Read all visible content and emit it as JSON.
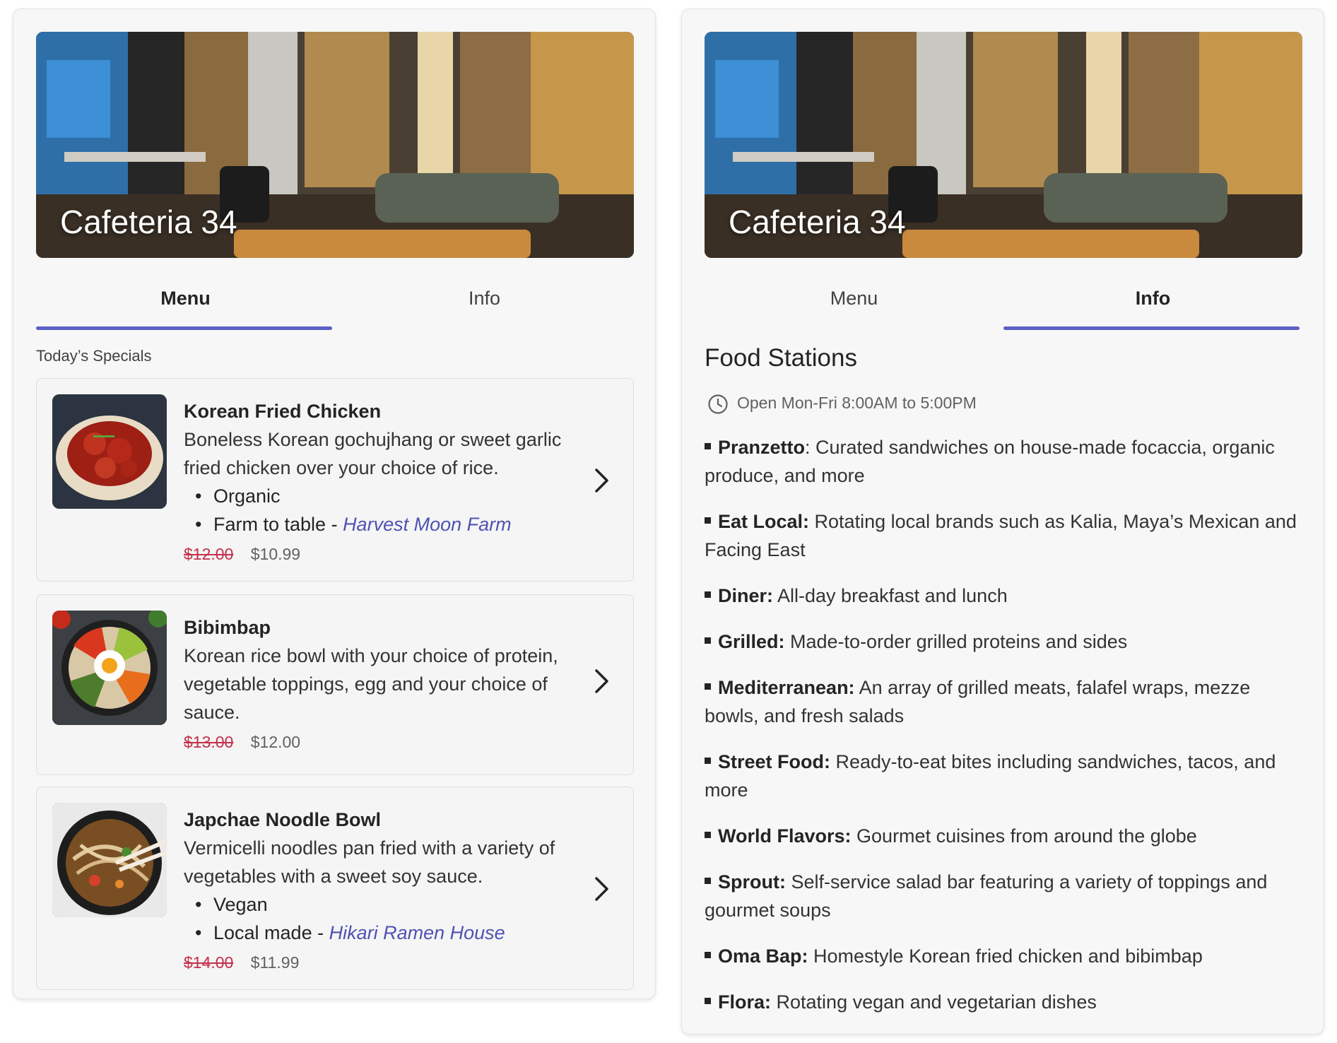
{
  "colors": {
    "accent": "#5b5fc7",
    "link": "#4f52b2",
    "strike_price": "#c4314b"
  },
  "menu_card": {
    "hero_title": "Cafeteria 34",
    "tabs": [
      {
        "label": "Menu",
        "active": true
      },
      {
        "label": "Info",
        "active": false
      }
    ],
    "section_label": "Today’s Specials",
    "items": [
      {
        "name": "Korean Fried Chicken",
        "description": "Boneless Korean gochujhang or sweet garlic fried chicken over your choice of rice.",
        "tags": [
          {
            "text": "Organic"
          },
          {
            "text": "Farm to table",
            "separator": " - ",
            "link": "Harvest Moon Farm"
          }
        ],
        "old_price": "$12.00",
        "price": "$10.99",
        "icon": "chevron-right-icon"
      },
      {
        "name": "Bibimbap",
        "description": "Korean rice bowl with your choice of protein, vegetable toppings, egg and your choice of sauce.",
        "tags": [],
        "old_price": "$13.00",
        "price": "$12.00",
        "icon": "chevron-right-icon"
      },
      {
        "name": "Japchae Noodle Bowl",
        "description": "Vermicelli noodles pan fried with a variety of vegetables with a sweet soy sauce.",
        "tags": [
          {
            "text": "Vegan"
          },
          {
            "text": "Local made",
            "separator": " - ",
            "link": "Hikari Ramen House"
          }
        ],
        "old_price": "$14.00",
        "price": "$11.99",
        "icon": "chevron-right-icon"
      }
    ]
  },
  "info_card": {
    "hero_title": "Cafeteria 34",
    "tabs": [
      {
        "label": "Menu",
        "active": false
      },
      {
        "label": "Info",
        "active": true
      }
    ],
    "heading": "Food Stations",
    "hours": "Open Mon-Fri 8:00AM to 5:00PM",
    "hours_icon": "clock-icon",
    "stations": [
      {
        "name": "Pranzetto",
        "text": ": Curated sandwiches on house-made focaccia, organic produce, and more"
      },
      {
        "name": "Eat Local:",
        "text": " Rotating local brands such as Kalia, Maya’s Mexican and Facing East"
      },
      {
        "name": "Diner:",
        "text": " All-day breakfast and lunch"
      },
      {
        "name": "Grilled:",
        "text": " Made-to-order grilled proteins and sides"
      },
      {
        "name": "Mediterranean:",
        "text": " An array of grilled meats, falafel wraps, mezze bowls, and fresh salads"
      },
      {
        "name": "Street Food:",
        "text": " Ready-to-eat bites including sandwiches, tacos, and more"
      },
      {
        "name": "World Flavors:",
        "text": " Gourmet cuisines from around the globe"
      },
      {
        "name": "Sprout:",
        "text": " Self-service salad bar featuring a variety of toppings and gourmet soups"
      },
      {
        "name": "Oma Bap:",
        "text": " Homestyle Korean fried chicken and bibimbap"
      },
      {
        "name": "Flora:",
        "text": " Rotating vegan and vegetarian dishes"
      }
    ]
  }
}
